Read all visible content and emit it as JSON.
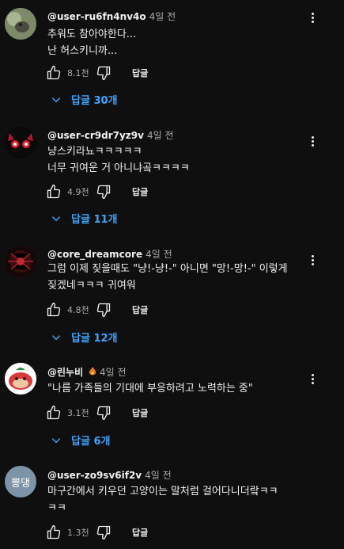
{
  "comments": [
    {
      "author": "@user-ru6fn4nv4o",
      "time": "4일 전",
      "lines": [
        "추워도 참아야한다...",
        "난 허스키니까..."
      ],
      "likes": "8.1천",
      "reply_label": "답글",
      "replies_label": "답글 30개"
    },
    {
      "author": "@user-cr9dr7yz9v",
      "time": "4일 전",
      "lines": [
        "냥스키라뇨ㅋㅋㅋㅋㅋ",
        "너무 귀여운 거 아니냐곸ㅋㅋㅋㅋ"
      ],
      "likes": "4.9천",
      "reply_label": "답글",
      "replies_label": "답글 11개"
    },
    {
      "author": "@core_dreamcore",
      "time": "4일 전",
      "lines": [
        "그럼 이제 짖을때도 \"냥!-냥!-\" 아니면 \"망!-망!-\" 이렇게",
        "짖겠네ㅋㅋㅋ 귀여워"
      ],
      "likes": "4.8천",
      "reply_label": "답글",
      "replies_label": "답글 12개"
    },
    {
      "author": "@린누비",
      "time": "4일 전",
      "lines": [
        "\"나름 가족들의 기대에 부응하려고 노력하는 중\""
      ],
      "likes": "3.1천",
      "reply_label": "답글",
      "replies_label": "답글 6개"
    },
    {
      "author": "@user-zo9sv6if2v",
      "time": "4일 전",
      "lines": [
        "마구간에서 키우던 고양이는 말처럼 걸어다니더랔ㅋㅋ",
        "ㅋㅋ"
      ],
      "likes": "1.3천",
      "reply_label": "답글",
      "avatar_text": "뽕댕"
    }
  ],
  "icons": {
    "like": "thumb-up-icon",
    "dislike": "thumb-down-icon",
    "menu": "more-vert-icon",
    "expand": "chevron-down-icon"
  },
  "colors": {
    "background": "#0f0f0f",
    "link": "#3ea6ff",
    "secondary_text": "#aaaaaa"
  }
}
